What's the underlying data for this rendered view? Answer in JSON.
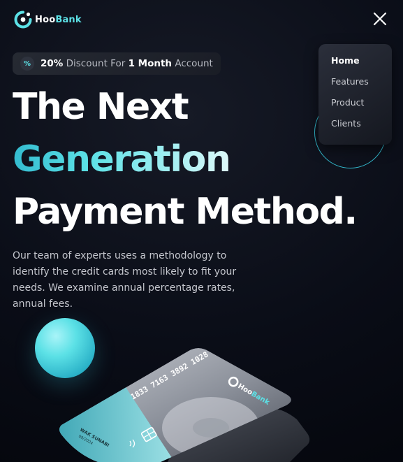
{
  "brand": {
    "name_white": "Hoo",
    "name_teal": "Bank",
    "logo_icon": "hoobank-logo-icon"
  },
  "header": {
    "close_icon": "close-icon"
  },
  "nav": {
    "items": [
      {
        "label": "Home",
        "active": true
      },
      {
        "label": "Features",
        "active": false
      },
      {
        "label": "Product",
        "active": false
      },
      {
        "label": "Clients",
        "active": false
      }
    ]
  },
  "badge": {
    "icon": "discount-icon",
    "percent": "20%",
    "mid": " Discount For ",
    "strong": "1 Month",
    "tail": " Account"
  },
  "hero": {
    "line1": "The Next",
    "line2": "Generation",
    "line3": "Payment Method.",
    "description": "Our team of experts uses a methodology to identify the credit cards most likely to fit your needs. We examine annual percentage rates, annual fees."
  },
  "card": {
    "number": "1833 7163 3892 1028",
    "holder": "WAK SUNABI",
    "expiry": "09/2024",
    "brand_white": "Hoo",
    "brand_teal": "Bank"
  },
  "colors": {
    "accent": "#5ce1e6",
    "accent_dark": "#33bbcf",
    "background": "#00040f"
  }
}
